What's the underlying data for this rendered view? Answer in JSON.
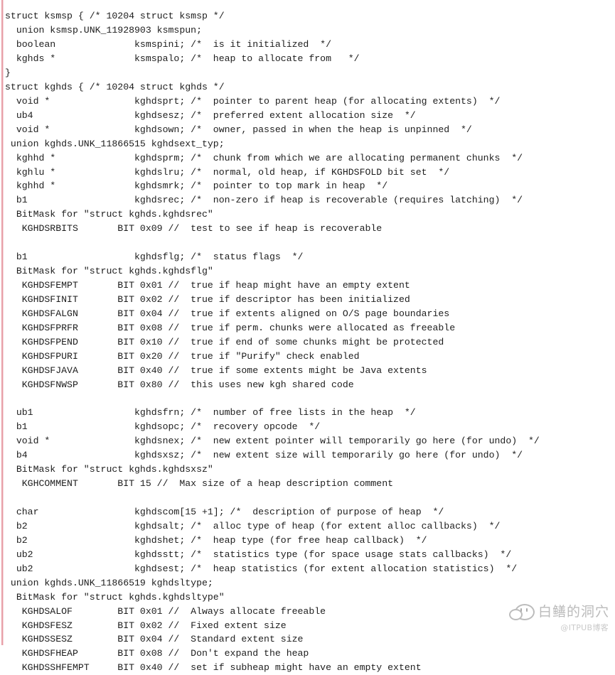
{
  "document": {
    "title": "Oracle struct dump: ksmsp / kghds",
    "text_color": "#1d1d1d",
    "background_color": "#ffffff",
    "rule_color": "#e8a0a8",
    "lines": [
      "struct ksmsp { /* 10204 struct ksmsp */",
      "  union ksmsp.UNK_11928903 ksmspun;",
      "  boolean              ksmspini; /*  is it initialized  */",
      "  kghds *              ksmspalo; /*  heap to allocate from   */",
      "}",
      "struct kghds { /* 10204 struct kghds */",
      "  void *               kghdsprt; /*  pointer to parent heap (for allocating extents)  */",
      "  ub4                  kghdsesz; /*  preferred extent allocation size  */",
      "  void *               kghdsown; /*  owner, passed in when the heap is unpinned  */",
      " union kghds.UNK_11866515 kghdsext_typ;",
      "  kghhd *              kghdsprm; /*  chunk from which we are allocating permanent chunks  */",
      "  kghlu *              kghdslru; /*  normal, old heap, if KGHDSFOLD bit set  */",
      "  kghhd *              kghdsmrk; /*  pointer to top mark in heap  */",
      "  b1                   kghdsrec; /*  non-zero if heap is recoverable (requires latching)  */",
      "  BitMask for \"struct kghds.kghdsrec\"",
      "   KGHDSRBITS       BIT 0x09 //  test to see if heap is recoverable",
      "",
      "  b1                   kghdsflg; /*  status flags  */",
      "  BitMask for \"struct kghds.kghdsflg\"",
      "   KGHDSFEMPT       BIT 0x01 //  true if heap might have an empty extent",
      "   KGHDSFINIT       BIT 0x02 //  true if descriptor has been initialized",
      "   KGHDSFALGN       BIT 0x04 //  true if extents aligned on O/S page boundaries",
      "   KGHDSFPRFR       BIT 0x08 //  true if perm. chunks were allocated as freeable",
      "   KGHDSFPEND       BIT 0x10 //  true if end of some chunks might be protected",
      "   KGHDSFPURI       BIT 0x20 //  true if \"Purify\" check enabled",
      "   KGHDSFJAVA       BIT 0x40 //  true if some extents might be Java extents",
      "   KGHDSFNWSP       BIT 0x80 //  this uses new kgh shared code",
      "",
      "  ub1                  kghdsfrn; /*  number of free lists in the heap  */",
      "  b1                   kghdsopc; /*  recovery opcode  */",
      "  void *               kghdsnex; /*  new extent pointer will temporarily go here (for undo)  */",
      "  b4                   kghdsxsz; /*  new extent size will temporarily go here (for undo)  */",
      "  BitMask for \"struct kghds.kghdsxsz\"",
      "   KGHCOMMENT       BIT 15 //  Max size of a heap description comment",
      "",
      "  char                 kghdscom[15 +1]; /*  description of purpose of heap  */",
      "  b2                   kghdsalt; /*  alloc type of heap (for extent alloc callbacks)  */",
      "  b2                   kghdshet; /*  heap type (for free heap callback)  */",
      "  ub2                  kghdsstt; /*  statistics type (for space usage stats callbacks)  */",
      "  ub2                  kghdsest; /*  heap statistics (for extent allocation statistics)  */",
      " union kghds.UNK_11866519 kghdsltype;",
      "  BitMask for \"struct kghds.kghdsltype\"",
      "   KGHDSALOF        BIT 0x01 //  Always allocate freeable",
      "   KGHDSFESZ        BIT 0x02 //  Fixed extent size",
      "   KGHDSSESZ        BIT 0x04 //  Standard extent size",
      "   KGHDSFHEAP       BIT 0x08 //  Don't expand the heap",
      "   KGHDSSHFEMPT     BIT 0x40 //  set if subheap might have an empty extent"
    ],
    "structs": [
      {
        "name": "ksmsp",
        "header": "struct ksmsp { /* 10204 struct ksmsp */",
        "version": "10204",
        "fields": [
          {
            "type": "union",
            "name": "ksmsp.UNK_11928903 ksmspun;",
            "comment": ""
          },
          {
            "type": "boolean",
            "name": "ksmspini;",
            "comment": "is it initialized"
          },
          {
            "type": "kghds *",
            "name": "ksmspalo;",
            "comment": "heap to allocate from"
          }
        ],
        "footer": "}"
      },
      {
        "name": "kghds",
        "header": "struct kghds { /* 10204 struct kghds */",
        "version": "10204",
        "fields": [
          {
            "type": "void *",
            "name": "kghdsprt;",
            "comment": "pointer to parent heap (for allocating extents)"
          },
          {
            "type": "ub4",
            "name": "kghdsesz;",
            "comment": "preferred extent allocation size"
          },
          {
            "type": "void *",
            "name": "kghdsown;",
            "comment": "owner, passed in when the heap is unpinned"
          },
          {
            "type": "union",
            "name": "kghds.UNK_11866515 kghdsext_typ;",
            "comment": ""
          },
          {
            "type": "kghhd *",
            "name": "kghdsprm;",
            "comment": "chunk from which we are allocating permanent chunks"
          },
          {
            "type": "kghlu *",
            "name": "kghdslru;",
            "comment": "normal, old heap, if KGHDSFOLD bit set"
          },
          {
            "type": "kghhd *",
            "name": "kghdsmrk;",
            "comment": "pointer to top mark in heap"
          },
          {
            "type": "b1",
            "name": "kghdsrec;",
            "comment": "non-zero if heap is recoverable (requires latching)"
          },
          {
            "type": "b1",
            "name": "kghdsflg;",
            "comment": "status flags"
          },
          {
            "type": "ub1",
            "name": "kghdsfrn;",
            "comment": "number of free lists in the heap"
          },
          {
            "type": "b1",
            "name": "kghdsopc;",
            "comment": "recovery opcode"
          },
          {
            "type": "void *",
            "name": "kghdsnex;",
            "comment": "new extent pointer will temporarily go here (for undo)"
          },
          {
            "type": "b4",
            "name": "kghdsxsz;",
            "comment": "new extent size will temporarily go here (for undo)"
          },
          {
            "type": "char",
            "name": "kghdscom[15 +1];",
            "comment": "description of purpose of heap"
          },
          {
            "type": "b2",
            "name": "kghdsalt;",
            "comment": "alloc type of heap (for extent alloc callbacks)"
          },
          {
            "type": "b2",
            "name": "kghdshet;",
            "comment": "heap type (for free heap callback)"
          },
          {
            "type": "ub2",
            "name": "kghdsstt;",
            "comment": "statistics type (for space usage stats callbacks)"
          },
          {
            "type": "ub2",
            "name": "kghdsest;",
            "comment": "heap statistics (for extent allocation statistics)"
          },
          {
            "type": "union",
            "name": "kghds.UNK_11866519 kghdsltype;",
            "comment": ""
          }
        ]
      }
    ],
    "bitmasks": [
      {
        "title": "BitMask for \"struct kghds.kghdsrec\"",
        "bits": [
          {
            "name": "KGHDSRBITS",
            "bit": "BIT 0x09",
            "comment": "test to see if heap is recoverable"
          }
        ]
      },
      {
        "title": "BitMask for \"struct kghds.kghdsflg\"",
        "bits": [
          {
            "name": "KGHDSFEMPT",
            "bit": "BIT 0x01",
            "comment": "true if heap might have an empty extent"
          },
          {
            "name": "KGHDSFINIT",
            "bit": "BIT 0x02",
            "comment": "true if descriptor has been initialized"
          },
          {
            "name": "KGHDSFALGN",
            "bit": "BIT 0x04",
            "comment": "true if extents aligned on O/S page boundaries"
          },
          {
            "name": "KGHDSFPRFR",
            "bit": "BIT 0x08",
            "comment": "true if perm. chunks were allocated as freeable"
          },
          {
            "name": "KGHDSFPEND",
            "bit": "BIT 0x10",
            "comment": "true if end of some chunks might be protected"
          },
          {
            "name": "KGHDSFPURI",
            "bit": "BIT 0x20",
            "comment": "true if \"Purify\" check enabled"
          },
          {
            "name": "KGHDSFJAVA",
            "bit": "BIT 0x40",
            "comment": "true if some extents might be Java extents"
          },
          {
            "name": "KGHDSFNWSP",
            "bit": "BIT 0x80",
            "comment": "this uses new kgh shared code"
          }
        ]
      },
      {
        "title": "BitMask for \"struct kghds.kghdsxsz\"",
        "bits": [
          {
            "name": "KGHCOMMENT",
            "bit": "BIT 15",
            "comment": "Max size of a heap description comment"
          }
        ]
      },
      {
        "title": "BitMask for \"struct kghds.kghdsltype\"",
        "bits": [
          {
            "name": "KGHDSALOF",
            "bit": "BIT 0x01",
            "comment": "Always allocate freeable"
          },
          {
            "name": "KGHDSFESZ",
            "bit": "BIT 0x02",
            "comment": "Fixed extent size"
          },
          {
            "name": "KGHDSSESZ",
            "bit": "BIT 0x04",
            "comment": "Standard extent size"
          },
          {
            "name": "KGHDSFHEAP",
            "bit": "BIT 0x08",
            "comment": "Don't expand the heap"
          },
          {
            "name": "KGHDSSHFEMPT",
            "bit": "BIT 0x40",
            "comment": "set if subheap might have an empty extent"
          }
        ]
      }
    ]
  },
  "watermark": {
    "title": "白鳝的洞穴",
    "subtitle": "@ITPUB博客",
    "color": "#8a8a8a"
  }
}
